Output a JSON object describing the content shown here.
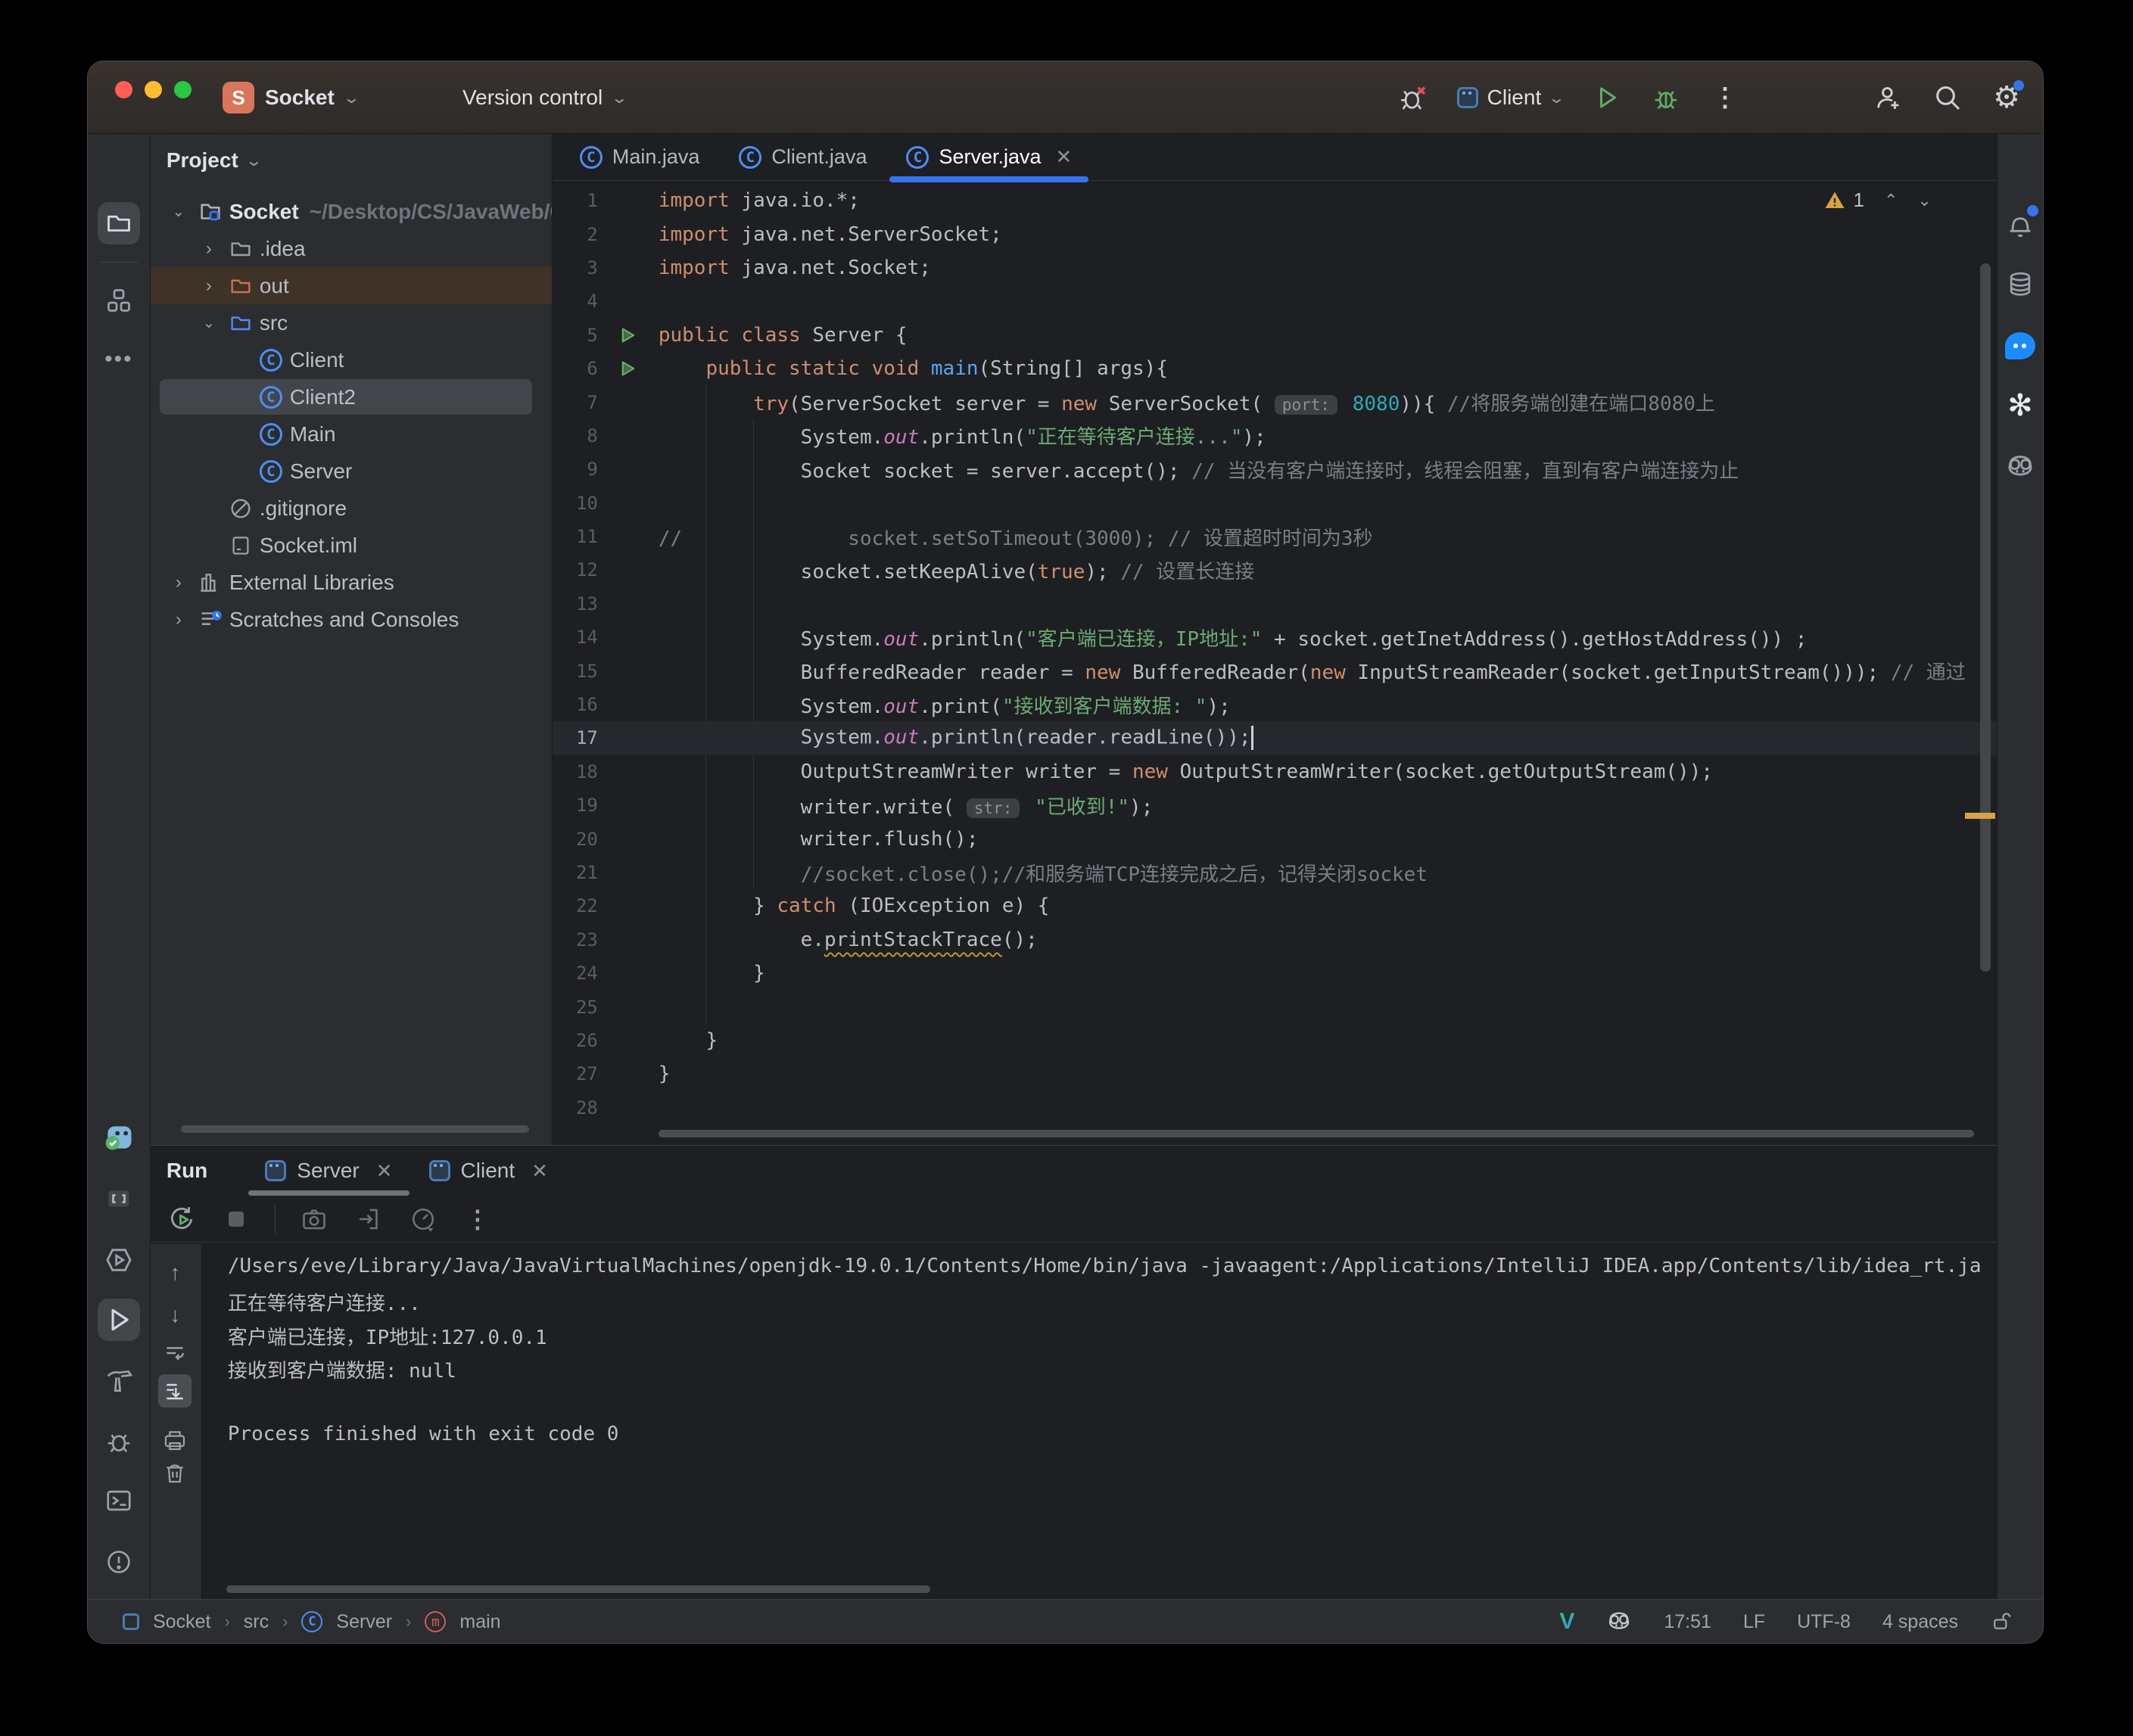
{
  "titlebar": {
    "project": "Socket",
    "version_control": "Version control",
    "run_config": "Client"
  },
  "project_panel": {
    "header": "Project",
    "tree": [
      {
        "label": "Socket",
        "path": "~/Desktop/CS/JavaWeb/C",
        "level": 0,
        "icon": "folder-project",
        "chevron": "down",
        "bold": true
      },
      {
        "label": ".idea",
        "level": 1,
        "icon": "folder",
        "chevron": "right"
      },
      {
        "label": "out",
        "level": 1,
        "icon": "folder-excluded",
        "chevron": "right",
        "highlight": "excluded"
      },
      {
        "label": "src",
        "level": 1,
        "icon": "folder-src",
        "chevron": "down"
      },
      {
        "label": "Client",
        "level": 2,
        "icon": "class"
      },
      {
        "label": "Client2",
        "level": 2,
        "icon": "class",
        "highlight": "selected"
      },
      {
        "label": "Main",
        "level": 2,
        "icon": "class"
      },
      {
        "label": "Server",
        "level": 2,
        "icon": "class"
      },
      {
        "label": ".gitignore",
        "level": 1,
        "icon": "ignored"
      },
      {
        "label": "Socket.iml",
        "level": 1,
        "icon": "iml"
      },
      {
        "label": "External Libraries",
        "level": 0,
        "icon": "library",
        "chevron": "right"
      },
      {
        "label": "Scratches and Consoles",
        "level": 0,
        "icon": "scratches",
        "chevron": "right"
      }
    ]
  },
  "editor": {
    "tabs": [
      {
        "label": "Main.java"
      },
      {
        "label": "Client.java"
      },
      {
        "label": "Server.java",
        "active": true,
        "close": true
      }
    ],
    "warning_count": "1",
    "lines": [
      {
        "n": 1,
        "tokens": [
          [
            "kw",
            "import"
          ],
          [
            "t",
            " java.io.*;"
          ]
        ]
      },
      {
        "n": 2,
        "tokens": [
          [
            "kw",
            "import"
          ],
          [
            "t",
            " java.net.ServerSocket;"
          ]
        ]
      },
      {
        "n": 3,
        "tokens": [
          [
            "kw",
            "import"
          ],
          [
            "t",
            " java.net.Socket;"
          ]
        ]
      },
      {
        "n": 4,
        "tokens": []
      },
      {
        "n": 5,
        "run": true,
        "tokens": [
          [
            "kw",
            "public"
          ],
          [
            "t",
            " "
          ],
          [
            "kw",
            "class"
          ],
          [
            "t",
            " Server {"
          ]
        ]
      },
      {
        "n": 6,
        "run": true,
        "tokens": [
          [
            "t",
            "    "
          ],
          [
            "kw",
            "public"
          ],
          [
            "t",
            " "
          ],
          [
            "kw",
            "static"
          ],
          [
            "t",
            " "
          ],
          [
            "kw",
            "void"
          ],
          [
            "t",
            " "
          ],
          [
            "mth",
            "main"
          ],
          [
            "t",
            "(String[] args){"
          ]
        ]
      },
      {
        "n": 7,
        "tokens": [
          [
            "t",
            "        "
          ],
          [
            "kw",
            "try"
          ],
          [
            "t",
            "(ServerSocket server = "
          ],
          [
            "kw",
            "new"
          ],
          [
            "t",
            " ServerSocket( "
          ],
          [
            "hint",
            "port:"
          ],
          [
            "t",
            " "
          ],
          [
            "num",
            "8080"
          ],
          [
            "t",
            ")){ "
          ],
          [
            "cmt",
            "//将服务端创建在端口8080上"
          ]
        ]
      },
      {
        "n": 8,
        "tokens": [
          [
            "t",
            "            System."
          ],
          [
            "fld",
            "out"
          ],
          [
            "t",
            ".println("
          ],
          [
            "str",
            "\"正在等待客户连接...\""
          ],
          [
            "t",
            ");"
          ]
        ]
      },
      {
        "n": 9,
        "tokens": [
          [
            "t",
            "            Socket socket = server.accept(); "
          ],
          [
            "cmt",
            "// 当没有客户端连接时，线程会阻塞，直到有客户端连接为止"
          ]
        ]
      },
      {
        "n": 10,
        "tokens": []
      },
      {
        "n": 11,
        "tokens": [
          [
            "cmt",
            "//              socket.setSoTimeout(3000); // 设置超时时间为3秒"
          ]
        ]
      },
      {
        "n": 12,
        "tokens": [
          [
            "t",
            "            socket.setKeepAlive("
          ],
          [
            "kw",
            "true"
          ],
          [
            "t",
            "); "
          ],
          [
            "cmt",
            "// 设置长连接"
          ]
        ]
      },
      {
        "n": 13,
        "tokens": []
      },
      {
        "n": 14,
        "tokens": [
          [
            "t",
            "            System."
          ],
          [
            "fld",
            "out"
          ],
          [
            "t",
            ".println("
          ],
          [
            "str",
            "\"客户端已连接，IP地址:\""
          ],
          [
            "t",
            " + socket.getInetAddress().getHostAddress()) ;"
          ]
        ]
      },
      {
        "n": 15,
        "tokens": [
          [
            "t",
            "            BufferedReader reader = "
          ],
          [
            "kw",
            "new"
          ],
          [
            "t",
            " BufferedReader("
          ],
          [
            "kw",
            "new"
          ],
          [
            "t",
            " InputStreamReader(socket.getInputStream())); "
          ],
          [
            "cmt",
            "// 通过"
          ]
        ]
      },
      {
        "n": 16,
        "tokens": [
          [
            "t",
            "            System."
          ],
          [
            "fld",
            "out"
          ],
          [
            "t",
            ".print("
          ],
          [
            "str",
            "\"接收到客户端数据: \""
          ],
          [
            "t",
            ");"
          ]
        ]
      },
      {
        "n": 17,
        "current": true,
        "tokens": [
          [
            "t",
            "            System."
          ],
          [
            "fld",
            "out"
          ],
          [
            "t",
            ".println(reader.readLine());"
          ],
          [
            "caret",
            ""
          ]
        ]
      },
      {
        "n": 18,
        "tokens": [
          [
            "t",
            "            OutputStreamWriter writer = "
          ],
          [
            "kw",
            "new"
          ],
          [
            "t",
            " OutputStreamWriter(socket.getOutputStream());"
          ]
        ]
      },
      {
        "n": 19,
        "tokens": [
          [
            "t",
            "            writer.write( "
          ],
          [
            "hint",
            "str:"
          ],
          [
            "t",
            " "
          ],
          [
            "str",
            "\"已收到!\""
          ],
          [
            "t",
            ");"
          ]
        ]
      },
      {
        "n": 20,
        "tokens": [
          [
            "t",
            "            writer.flush();"
          ]
        ]
      },
      {
        "n": 21,
        "tokens": [
          [
            "t",
            "            "
          ],
          [
            "cmt",
            "//socket.close();//和服务端TCP连接完成之后，记得关闭socket"
          ]
        ]
      },
      {
        "n": 22,
        "tokens": [
          [
            "t",
            "        } "
          ],
          [
            "kw",
            "catch"
          ],
          [
            "t",
            " (IOException e) {"
          ]
        ]
      },
      {
        "n": 23,
        "tokens": [
          [
            "t",
            "            e."
          ],
          [
            "warn",
            "printStackTrace"
          ],
          [
            "t",
            "();"
          ]
        ]
      },
      {
        "n": 24,
        "tokens": [
          [
            "t",
            "        }"
          ]
        ]
      },
      {
        "n": 25,
        "tokens": []
      },
      {
        "n": 26,
        "tokens": [
          [
            "t",
            "    }"
          ]
        ]
      },
      {
        "n": 27,
        "tokens": [
          [
            "t",
            "}"
          ]
        ]
      },
      {
        "n": 28,
        "tokens": []
      }
    ]
  },
  "run": {
    "caption": "Run",
    "tabs": [
      {
        "label": "Server",
        "active": true
      },
      {
        "label": "Client"
      }
    ],
    "console": [
      "/Users/eve/Library/Java/JavaVirtualMachines/openjdk-19.0.1/Contents/Home/bin/java -javaagent:/Applications/IntelliJ IDEA.app/Contents/lib/idea_rt.ja",
      "正在等待客户连接...",
      "客户端已连接，IP地址:127.0.0.1",
      "接收到客户端数据: null",
      "",
      "Process finished with exit code 0"
    ]
  },
  "statusbar": {
    "breadcrumbs": [
      "Socket",
      "src",
      "Server",
      "main"
    ],
    "time": "17:51",
    "line_sep": "LF",
    "encoding": "UTF-8",
    "indent": "4 spaces"
  },
  "colors": {
    "accent_blue": "#3574f0",
    "keyword_orange": "#cf8e6d",
    "string_green": "#6aab73",
    "number_cyan": "#2aacb8",
    "comment_gray": "#7a7e85",
    "field_purple": "#c77dbb",
    "method_blue": "#56a8f5",
    "run_green": "#5fad65",
    "warning_yellow": "#d9a343",
    "excluded_row_brown": "#3f3226",
    "traffic_red": "#ff5f57",
    "traffic_yellow": "#febc2e",
    "traffic_green": "#28c840"
  }
}
